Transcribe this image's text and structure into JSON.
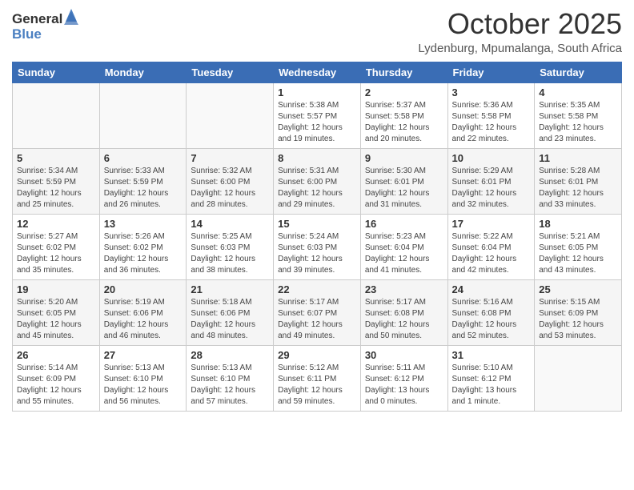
{
  "logo": {
    "text_general": "General",
    "text_blue": "Blue"
  },
  "header": {
    "month": "October 2025",
    "location": "Lydenburg, Mpumalanga, South Africa"
  },
  "weekdays": [
    "Sunday",
    "Monday",
    "Tuesday",
    "Wednesday",
    "Thursday",
    "Friday",
    "Saturday"
  ],
  "weeks": [
    [
      {
        "day": "",
        "sunrise": "",
        "sunset": "",
        "daylight": ""
      },
      {
        "day": "",
        "sunrise": "",
        "sunset": "",
        "daylight": ""
      },
      {
        "day": "",
        "sunrise": "",
        "sunset": "",
        "daylight": ""
      },
      {
        "day": "1",
        "sunrise": "Sunrise: 5:38 AM",
        "sunset": "Sunset: 5:57 PM",
        "daylight": "Daylight: 12 hours and 19 minutes."
      },
      {
        "day": "2",
        "sunrise": "Sunrise: 5:37 AM",
        "sunset": "Sunset: 5:58 PM",
        "daylight": "Daylight: 12 hours and 20 minutes."
      },
      {
        "day": "3",
        "sunrise": "Sunrise: 5:36 AM",
        "sunset": "Sunset: 5:58 PM",
        "daylight": "Daylight: 12 hours and 22 minutes."
      },
      {
        "day": "4",
        "sunrise": "Sunrise: 5:35 AM",
        "sunset": "Sunset: 5:58 PM",
        "daylight": "Daylight: 12 hours and 23 minutes."
      }
    ],
    [
      {
        "day": "5",
        "sunrise": "Sunrise: 5:34 AM",
        "sunset": "Sunset: 5:59 PM",
        "daylight": "Daylight: 12 hours and 25 minutes."
      },
      {
        "day": "6",
        "sunrise": "Sunrise: 5:33 AM",
        "sunset": "Sunset: 5:59 PM",
        "daylight": "Daylight: 12 hours and 26 minutes."
      },
      {
        "day": "7",
        "sunrise": "Sunrise: 5:32 AM",
        "sunset": "Sunset: 6:00 PM",
        "daylight": "Daylight: 12 hours and 28 minutes."
      },
      {
        "day": "8",
        "sunrise": "Sunrise: 5:31 AM",
        "sunset": "Sunset: 6:00 PM",
        "daylight": "Daylight: 12 hours and 29 minutes."
      },
      {
        "day": "9",
        "sunrise": "Sunrise: 5:30 AM",
        "sunset": "Sunset: 6:01 PM",
        "daylight": "Daylight: 12 hours and 31 minutes."
      },
      {
        "day": "10",
        "sunrise": "Sunrise: 5:29 AM",
        "sunset": "Sunset: 6:01 PM",
        "daylight": "Daylight: 12 hours and 32 minutes."
      },
      {
        "day": "11",
        "sunrise": "Sunrise: 5:28 AM",
        "sunset": "Sunset: 6:01 PM",
        "daylight": "Daylight: 12 hours and 33 minutes."
      }
    ],
    [
      {
        "day": "12",
        "sunrise": "Sunrise: 5:27 AM",
        "sunset": "Sunset: 6:02 PM",
        "daylight": "Daylight: 12 hours and 35 minutes."
      },
      {
        "day": "13",
        "sunrise": "Sunrise: 5:26 AM",
        "sunset": "Sunset: 6:02 PM",
        "daylight": "Daylight: 12 hours and 36 minutes."
      },
      {
        "day": "14",
        "sunrise": "Sunrise: 5:25 AM",
        "sunset": "Sunset: 6:03 PM",
        "daylight": "Daylight: 12 hours and 38 minutes."
      },
      {
        "day": "15",
        "sunrise": "Sunrise: 5:24 AM",
        "sunset": "Sunset: 6:03 PM",
        "daylight": "Daylight: 12 hours and 39 minutes."
      },
      {
        "day": "16",
        "sunrise": "Sunrise: 5:23 AM",
        "sunset": "Sunset: 6:04 PM",
        "daylight": "Daylight: 12 hours and 41 minutes."
      },
      {
        "day": "17",
        "sunrise": "Sunrise: 5:22 AM",
        "sunset": "Sunset: 6:04 PM",
        "daylight": "Daylight: 12 hours and 42 minutes."
      },
      {
        "day": "18",
        "sunrise": "Sunrise: 5:21 AM",
        "sunset": "Sunset: 6:05 PM",
        "daylight": "Daylight: 12 hours and 43 minutes."
      }
    ],
    [
      {
        "day": "19",
        "sunrise": "Sunrise: 5:20 AM",
        "sunset": "Sunset: 6:05 PM",
        "daylight": "Daylight: 12 hours and 45 minutes."
      },
      {
        "day": "20",
        "sunrise": "Sunrise: 5:19 AM",
        "sunset": "Sunset: 6:06 PM",
        "daylight": "Daylight: 12 hours and 46 minutes."
      },
      {
        "day": "21",
        "sunrise": "Sunrise: 5:18 AM",
        "sunset": "Sunset: 6:06 PM",
        "daylight": "Daylight: 12 hours and 48 minutes."
      },
      {
        "day": "22",
        "sunrise": "Sunrise: 5:17 AM",
        "sunset": "Sunset: 6:07 PM",
        "daylight": "Daylight: 12 hours and 49 minutes."
      },
      {
        "day": "23",
        "sunrise": "Sunrise: 5:17 AM",
        "sunset": "Sunset: 6:08 PM",
        "daylight": "Daylight: 12 hours and 50 minutes."
      },
      {
        "day": "24",
        "sunrise": "Sunrise: 5:16 AM",
        "sunset": "Sunset: 6:08 PM",
        "daylight": "Daylight: 12 hours and 52 minutes."
      },
      {
        "day": "25",
        "sunrise": "Sunrise: 5:15 AM",
        "sunset": "Sunset: 6:09 PM",
        "daylight": "Daylight: 12 hours and 53 minutes."
      }
    ],
    [
      {
        "day": "26",
        "sunrise": "Sunrise: 5:14 AM",
        "sunset": "Sunset: 6:09 PM",
        "daylight": "Daylight: 12 hours and 55 minutes."
      },
      {
        "day": "27",
        "sunrise": "Sunrise: 5:13 AM",
        "sunset": "Sunset: 6:10 PM",
        "daylight": "Daylight: 12 hours and 56 minutes."
      },
      {
        "day": "28",
        "sunrise": "Sunrise: 5:13 AM",
        "sunset": "Sunset: 6:10 PM",
        "daylight": "Daylight: 12 hours and 57 minutes."
      },
      {
        "day": "29",
        "sunrise": "Sunrise: 5:12 AM",
        "sunset": "Sunset: 6:11 PM",
        "daylight": "Daylight: 12 hours and 59 minutes."
      },
      {
        "day": "30",
        "sunrise": "Sunrise: 5:11 AM",
        "sunset": "Sunset: 6:12 PM",
        "daylight": "Daylight: 13 hours and 0 minutes."
      },
      {
        "day": "31",
        "sunrise": "Sunrise: 5:10 AM",
        "sunset": "Sunset: 6:12 PM",
        "daylight": "Daylight: 13 hours and 1 minute."
      },
      {
        "day": "",
        "sunrise": "",
        "sunset": "",
        "daylight": ""
      }
    ]
  ]
}
